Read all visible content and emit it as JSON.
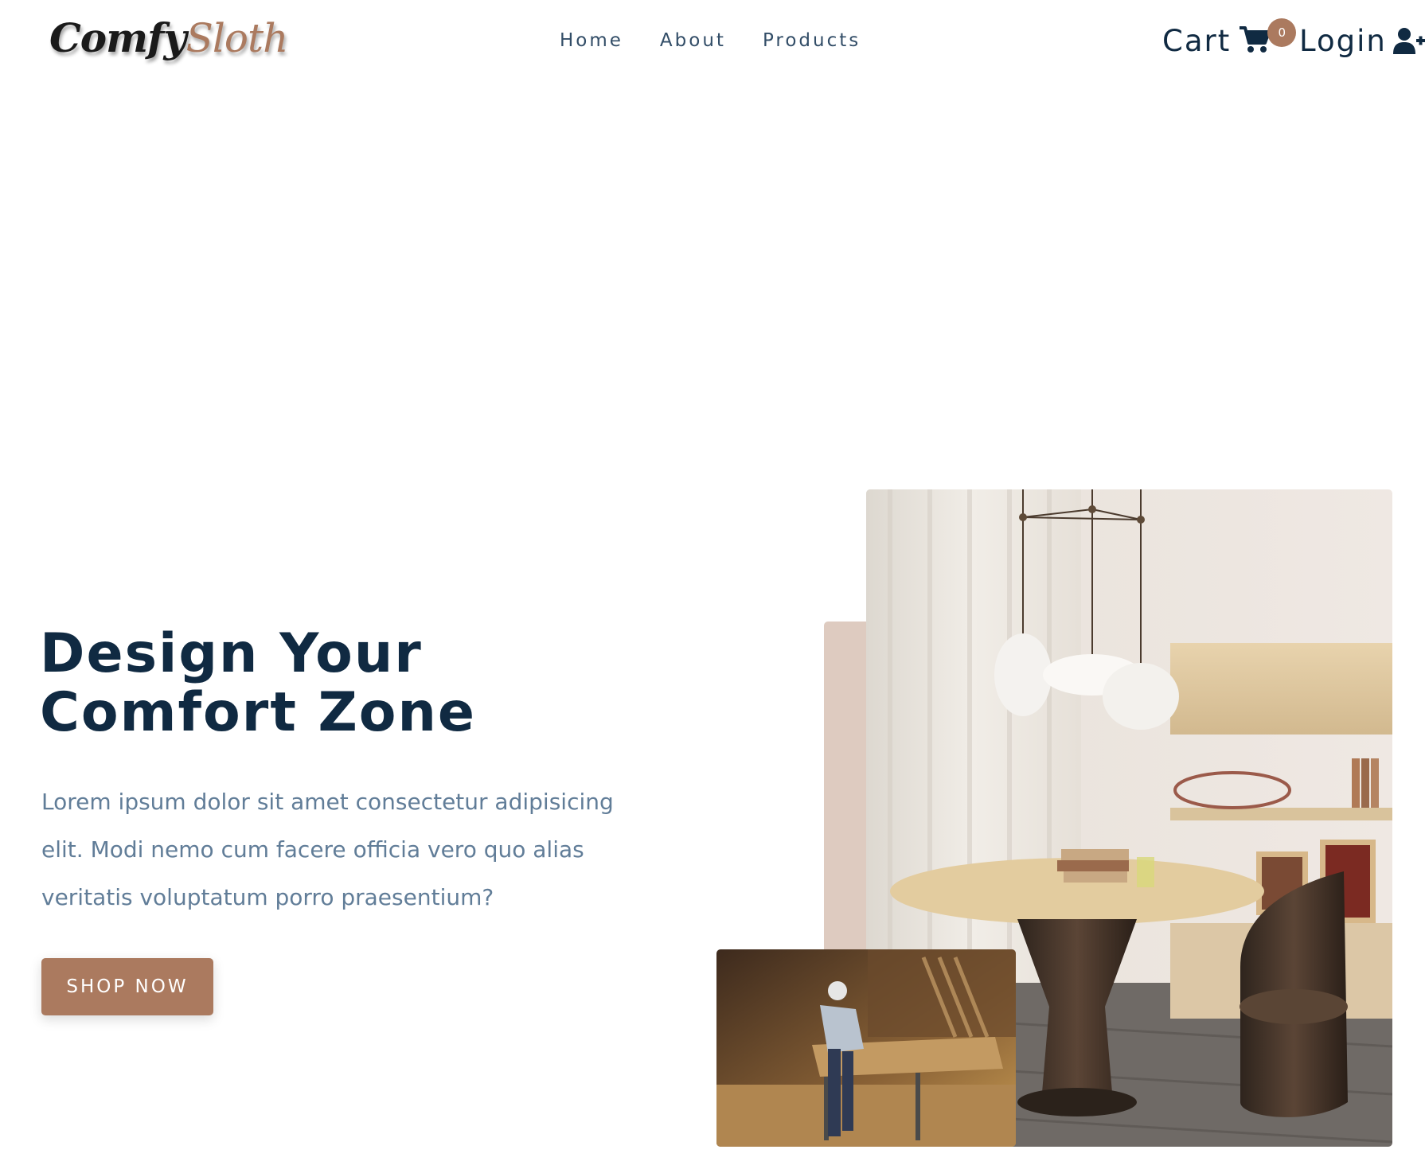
{
  "brand": {
    "logo_part1": "Comfy",
    "logo_part2": "Sloth",
    "accent_color": "#ab7a5f",
    "primary_color": "#102a42"
  },
  "nav": {
    "links": [
      {
        "label": "Home"
      },
      {
        "label": "About"
      },
      {
        "label": "Products"
      }
    ],
    "cart_label": "Cart",
    "cart_icon": "cart-icon",
    "cart_count": "0",
    "login_label": "Login",
    "login_icon": "user-plus-icon"
  },
  "hero": {
    "title_line1": "Design Your",
    "title_line2": "Comfort Zone",
    "text": "Lorem ipsum dolor sit amet consectetur adipisicing elit. Modi nemo cum facere officia vero quo alias veritatis voluptatum porro praesentium?",
    "cta_label": "Shop Now"
  }
}
